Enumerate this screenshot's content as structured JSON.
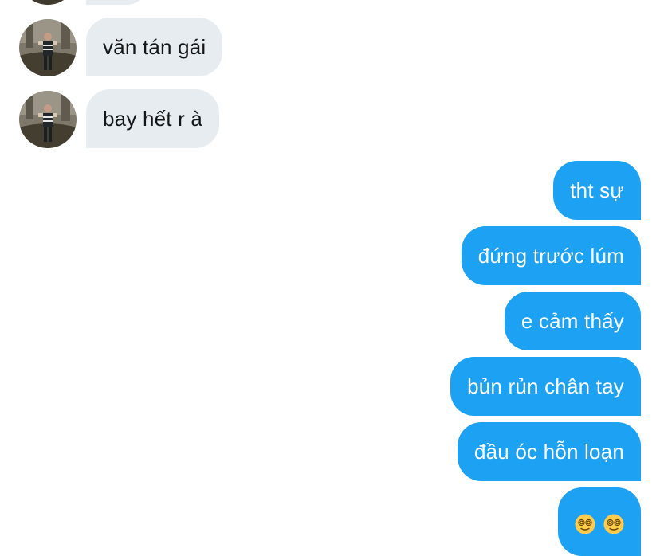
{
  "conversation": {
    "incoming": [
      {
        "text": "văn tán gái"
      },
      {
        "text": "bay hết r à"
      }
    ],
    "outgoing": [
      {
        "text": "tht sự"
      },
      {
        "text": "đứng trước lúm"
      },
      {
        "text": "e cảm thấy"
      },
      {
        "text": "bủn rủn chân tay"
      },
      {
        "text": "đầu óc hỗn loạn"
      }
    ],
    "emoji_message": [
      "dizzy-face-emoji",
      "dizzy-face-emoji"
    ]
  },
  "colors": {
    "incoming_bubble": "#e6ecf0",
    "outgoing_bubble": "#1da1f2",
    "incoming_text": "#14171a",
    "outgoing_text": "#ffffff"
  }
}
